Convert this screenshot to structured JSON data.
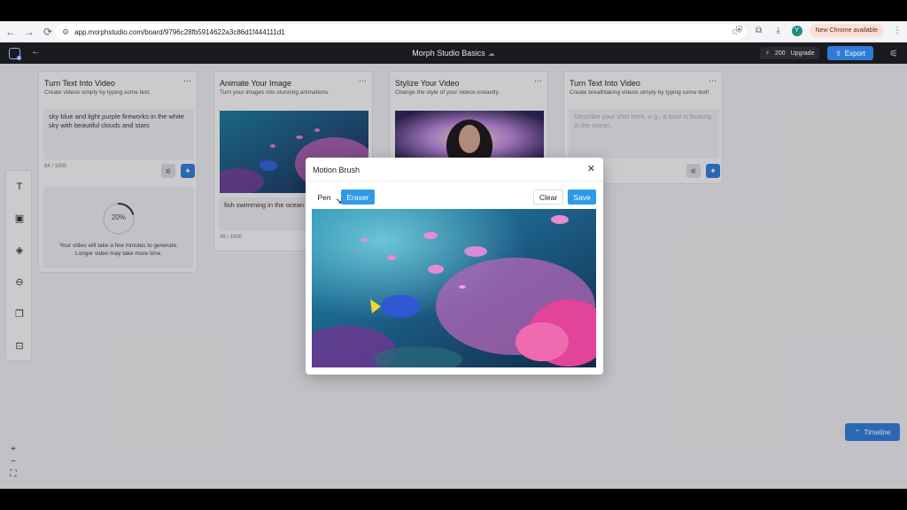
{
  "browser": {
    "url": "app.morphstudio.com/board/9796c28fb5914622a3c86d1f444111d1",
    "new_chrome_label": "New Chrome available",
    "profile_initial": "Y"
  },
  "header": {
    "title": "Morph Studio Basics",
    "credits": "200",
    "upgrade_label": "Upgrade",
    "export_label": "Export"
  },
  "cards": [
    {
      "title": "Turn Text Into Video",
      "subtitle": "Create videos simply by typing some text.",
      "prompt": "sky blue and light purple fireworks in the white sky with beautiful clouds and stars",
      "counter": "84 / 1000",
      "progress": "20%",
      "progress_fraction": 0.2,
      "progress_msg_1": "Your video will take a few minutes to generate.",
      "progress_msg_2": "Longer video may take more time."
    },
    {
      "title": "Animate Your Image",
      "subtitle": "Turn your images into stunning animations.",
      "prompt": "fish swimming in the ocean reef",
      "counter": "49 / 1000"
    },
    {
      "title": "Stylize Your Video",
      "subtitle": "Change the style of your videos instantly."
    },
    {
      "title": "Turn Text Into Video",
      "subtitle": "Create breathtaking videos simply by typing some text!",
      "placeholder": "Describe your shot here, e.g., a boat is floating in the ocean."
    }
  ],
  "modal": {
    "title": "Motion Brush",
    "pen_label": "Pen",
    "eraser_label": "Eraser",
    "clear_label": "Clear",
    "save_label": "Save"
  },
  "timeline_label": "Timeline",
  "colors": {
    "accent": "#2f7bd8",
    "modal_accent": "#2f9ae6",
    "header_bg": "#1b1b1f"
  }
}
